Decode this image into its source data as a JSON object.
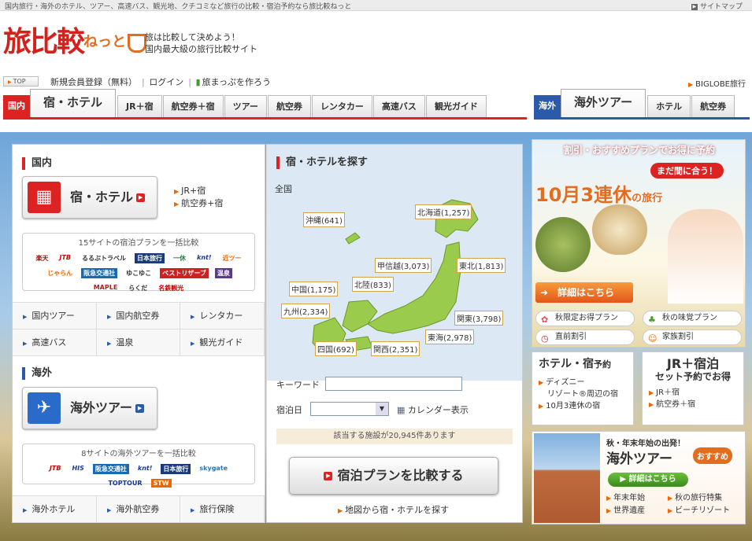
{
  "topbar": {
    "tagline": "国内旅行・海外のホテル、ツアー、高速バス、観光地、クチコミなど旅行の比較・宿泊予約なら旅比較ねっと",
    "sitemap": "サイトマップ"
  },
  "brand": {
    "logo_main": "旅比較",
    "logo_small": "ねっと",
    "catch1": "旅は比較して決めよう！",
    "catch2": "国内最大級の旅行比較サイト"
  },
  "nav": {
    "top": "TOP",
    "register": "新規会員登録（無料）",
    "login": "ログイン",
    "tabimap": "旅まっぷを作ろう",
    "biglobe": "BIGLOBE旅行"
  },
  "tabs_domestic": {
    "flag": "国内",
    "main": "宿・ホテル",
    "items": [
      "JR＋宿",
      "航空券＋宿",
      "ツアー",
      "航空券",
      "レンタカー",
      "高速バス",
      "観光ガイド"
    ]
  },
  "tabs_overseas": {
    "flag": "海外",
    "main": "海外ツアー",
    "items": [
      "ホテル",
      "航空券"
    ]
  },
  "left": {
    "domestic_head": "国内",
    "hotel_btn": "宿・ホテル",
    "hotel_links": [
      "JR+宿",
      "航空券+宿"
    ],
    "hotel_compare": "15サイトの宿泊プランを一括比較",
    "hotel_logos": [
      "楽天",
      "JTB",
      "るるぶトラベル",
      "日本旅行",
      "一休",
      "knt!",
      "近ツー",
      "じゃらん",
      "阪急交通社",
      "ゆこゆこ",
      "ベストリザーブ",
      "温泉",
      "MAPLE",
      "らくだ",
      "名鉄観光"
    ],
    "domestic_links": [
      "国内ツアー",
      "国内航空券",
      "レンタカー",
      "高速バス",
      "温泉",
      "観光ガイド"
    ],
    "overseas_head": "海外",
    "tour_btn": "海外ツアー",
    "tour_compare": "8サイトの海外ツアーを一括比較",
    "tour_logos": [
      "JTB",
      "HIS",
      "阪急交通社",
      "knt!",
      "日本旅行",
      "skygate",
      "TOPTOUR",
      "STW"
    ],
    "overseas_links": [
      "海外ホテル",
      "海外航空券",
      "旅行保険"
    ]
  },
  "center": {
    "head": "宿・ホテルを探す",
    "nationwide": "全国",
    "regions": [
      {
        "label": "沖縄(641)"
      },
      {
        "label": "北海道(1,257)"
      },
      {
        "label": "甲信越(3,073)"
      },
      {
        "label": "東北(1,813)"
      },
      {
        "label": "中国(1,175)"
      },
      {
        "label": "北陸(833)"
      },
      {
        "label": "九州(2,334)"
      },
      {
        "label": "関東(3,798)"
      },
      {
        "label": "東海(2,978)"
      },
      {
        "label": "四国(692)"
      },
      {
        "label": "関西(2,351)"
      }
    ],
    "keyword_label": "キーワード",
    "date_label": "宿泊日",
    "calendar": "カレンダー表示",
    "count": "該当する施設が20,945件あります",
    "compare_btn": "宿泊プランを比較する",
    "map_link": "地図から宿・ホテルを探す"
  },
  "right": {
    "banner_top": "割引・おすすめプランでお得に予約",
    "banner_badge": "まだ間に合う！",
    "banner_main": "10月3連休",
    "banner_main_small": "の旅行",
    "detail_btn": "詳細はこちら",
    "pills": [
      "秋限定お得プラン",
      "秋の味覚プラン",
      "直前割引",
      "家族割引"
    ],
    "hotel_box": {
      "title": "ホテル・宿",
      "title_small": "予約",
      "links": [
        "ディズニー",
        "リゾート®周辺の宿",
        "10月3連休の宿"
      ]
    },
    "jr_box": {
      "title": "JR＋宿泊",
      "sub": "セット予約でお得",
      "links": [
        "JR＋宿",
        "航空券＋宿"
      ]
    },
    "abroad": {
      "t1": "秋・年末年始の出発！",
      "t2": "海外ツアー",
      "rec": "おすすめ",
      "detail": "詳細はこちら",
      "links": [
        "年末年始",
        "秋の旅行特集",
        "世界遺産",
        "ビーチリゾート"
      ]
    }
  }
}
